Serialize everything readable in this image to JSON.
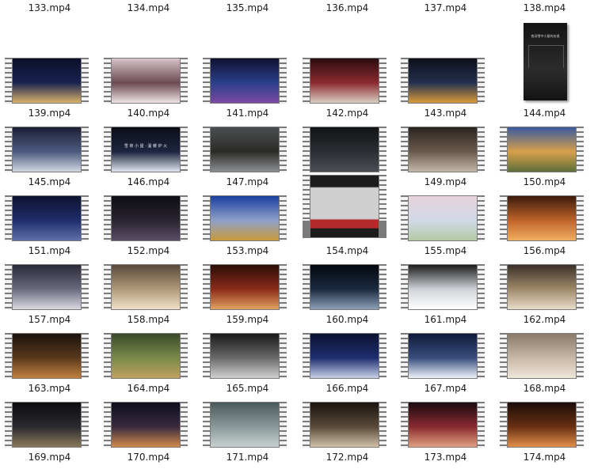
{
  "window": {
    "title": ""
  },
  "top_labels": [
    "133.mp4",
    "134.mp4",
    "135.mp4",
    "136.mp4",
    "137.mp4",
    "138.mp4"
  ],
  "rows": [
    {
      "items": [
        {
          "name": "139.mp4",
          "colors": [
            "#0b0f2a",
            "#1a2350",
            "#d9b26a"
          ]
        },
        {
          "name": "140.mp4",
          "colors": [
            "#d8c2c9",
            "#6b4a52",
            "#efe3e6"
          ]
        },
        {
          "name": "141.mp4",
          "colors": [
            "#0e1130",
            "#2b3f8c",
            "#7a4aa0"
          ]
        },
        {
          "name": "142.mp4",
          "colors": [
            "#2a0d10",
            "#8c2b2f",
            "#d9cfc2"
          ]
        },
        {
          "name": "143.mp4",
          "colors": [
            "#0d0f1a",
            "#23314f",
            "#d99a3a"
          ]
        },
        {
          "name": "144.mp4",
          "colors": [
            "#141414",
            "#2c2c2c",
            "#888888"
          ],
          "portrait": true,
          "caption": "夜深雪中小屋的安逸"
        }
      ]
    },
    {
      "items": [
        {
          "name": "145.mp4",
          "colors": [
            "#1c2035",
            "#4d5a80",
            "#cfd6e0"
          ]
        },
        {
          "name": "146.mp4",
          "colors": [
            "#0b0d18",
            "#1d2540",
            "#dfe6ef"
          ],
          "caption": "雪 夜 小 屋 · 温 暖 炉 火"
        },
        {
          "name": "147.mp4",
          "colors": [
            "#4a4f52",
            "#2c2a26",
            "#8c8f92"
          ]
        },
        {
          "name": "148.mp4",
          "colors": [
            "#121416",
            "#2b2e33",
            "#4b4f55"
          ]
        },
        {
          "name": "149.mp4",
          "colors": [
            "#2a2420",
            "#6b5a4d",
            "#c4b8a8"
          ]
        },
        {
          "name": "150.mp4",
          "colors": [
            "#3a5aa0",
            "#d9a04a",
            "#5c6e3a"
          ]
        }
      ]
    },
    {
      "items": [
        {
          "name": "151.mp4",
          "colors": [
            "#0c1230",
            "#1f2e6b",
            "#5f6fa8"
          ]
        },
        {
          "name": "152.mp4",
          "colors": [
            "#0d0d12",
            "#2a2431",
            "#5a4d66"
          ]
        },
        {
          "name": "153.mp4",
          "colors": [
            "#1b3fa0",
            "#8fa0c8",
            "#c99a3c"
          ]
        },
        {
          "name": "154.mp4",
          "colors": [
            "#cfcfcf",
            "#1c1c1c",
            "#b22a2a"
          ],
          "tall": true
        },
        {
          "name": "155.mp4",
          "colors": [
            "#e8d3dc",
            "#cfd9e6",
            "#b6c9a6"
          ]
        },
        {
          "name": "156.mp4",
          "colors": [
            "#3a1a0c",
            "#c0642a",
            "#f0b060"
          ]
        }
      ]
    },
    {
      "items": [
        {
          "name": "157.mp4",
          "colors": [
            "#2a2a38",
            "#6a6a80",
            "#d9d9e0"
          ]
        },
        {
          "name": "158.mp4",
          "colors": [
            "#5a4a3a",
            "#b09a7a",
            "#efe0c8"
          ]
        },
        {
          "name": "159.mp4",
          "colors": [
            "#2a0e08",
            "#8c2c1a",
            "#e0a060"
          ]
        },
        {
          "name": "160.mp4",
          "colors": [
            "#05070d",
            "#1a2a40",
            "#8ca0b8"
          ]
        },
        {
          "name": "161.mp4",
          "colors": [
            "#1c1c1c",
            "#cfd3d8",
            "#ffffff"
          ]
        },
        {
          "name": "162.mp4",
          "colors": [
            "#3a3028",
            "#a08a6a",
            "#e8dcc8"
          ]
        }
      ]
    },
    {
      "items": [
        {
          "name": "163.mp4",
          "colors": [
            "#1a120c",
            "#5a3a1c",
            "#c08040"
          ]
        },
        {
          "name": "164.mp4",
          "colors": [
            "#3a4a2a",
            "#7a8a4a",
            "#c0a060"
          ]
        },
        {
          "name": "165.mp4",
          "colors": [
            "#1a1a1a",
            "#6a6a6a",
            "#d0d0d0"
          ]
        },
        {
          "name": "166.mp4",
          "colors": [
            "#0a1230",
            "#1f3070",
            "#c8d0e8"
          ]
        },
        {
          "name": "167.mp4",
          "colors": [
            "#0f1a3a",
            "#3a4f80",
            "#eef2f8"
          ]
        },
        {
          "name": "168.mp4",
          "colors": [
            "#8a7a6a",
            "#c8b8a6",
            "#f0e6dc"
          ]
        }
      ]
    },
    {
      "items": [
        {
          "name": "169.mp4",
          "colors": [
            "#0c0c10",
            "#2a2a30",
            "#8a7a5a"
          ]
        },
        {
          "name": "170.mp4",
          "colors": [
            "#0c0e1c",
            "#3a2a40",
            "#d08a4a"
          ]
        },
        {
          "name": "171.mp4",
          "colors": [
            "#4a5a5a",
            "#8a9a9a",
            "#c8d0d0"
          ]
        },
        {
          "name": "172.mp4",
          "colors": [
            "#1a1410",
            "#5a4a3a",
            "#d0c0a8"
          ]
        },
        {
          "name": "173.mp4",
          "colors": [
            "#1a0c10",
            "#8a2a30",
            "#e0a080"
          ]
        },
        {
          "name": "174.mp4",
          "colors": [
            "#1a0c06",
            "#6a3012",
            "#e0904a"
          ]
        }
      ]
    }
  ]
}
